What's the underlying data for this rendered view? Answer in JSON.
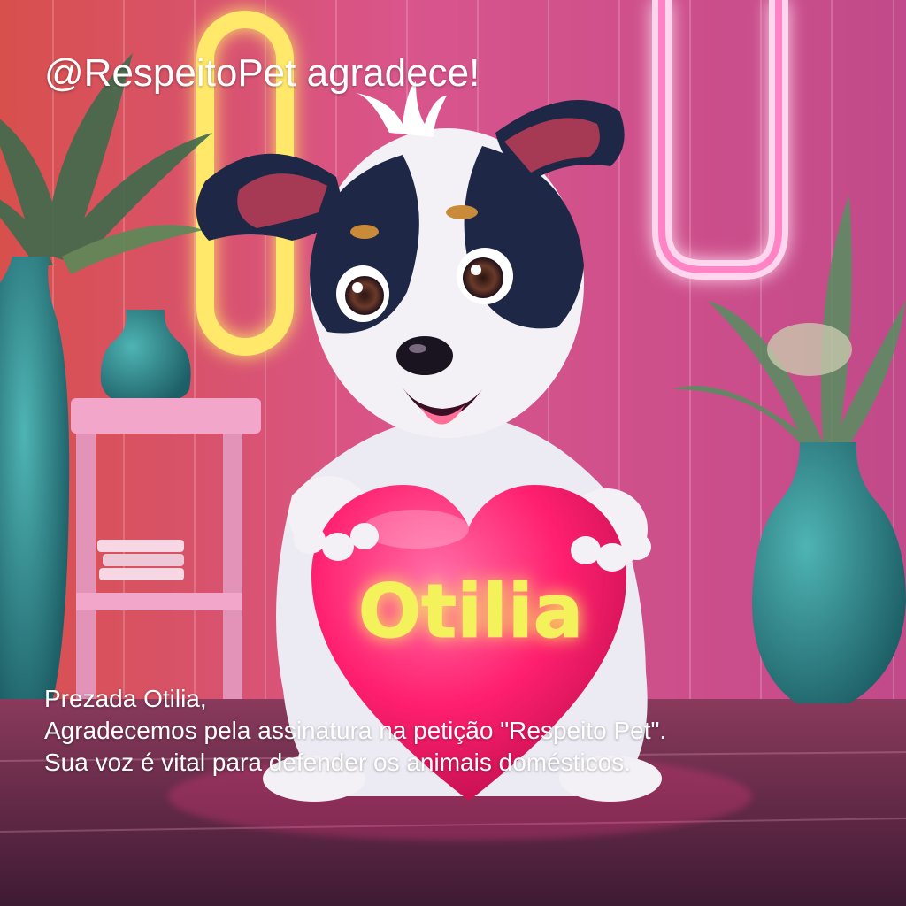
{
  "overlay": {
    "headline": "@RespeitoPet agradece!",
    "greeting": "Prezada Otilia,",
    "line1": "Agradecemos pela assinatura na petição \"Respeito Pet\".",
    "line2": "Sua voz é vital para defender os animais domésticos."
  },
  "illustration": {
    "heart_text": "Otilia",
    "subject": "puppy-holding-heart",
    "palette": {
      "wall": "#e05a8c",
      "neon_yellow": "#ffe86a",
      "neon_pink": "#ff5fb4",
      "heart": "#ff1f6e",
      "vase": "#2f8a8e",
      "dog_dark": "#1e2745",
      "dog_light": "#f4f1f6"
    }
  }
}
